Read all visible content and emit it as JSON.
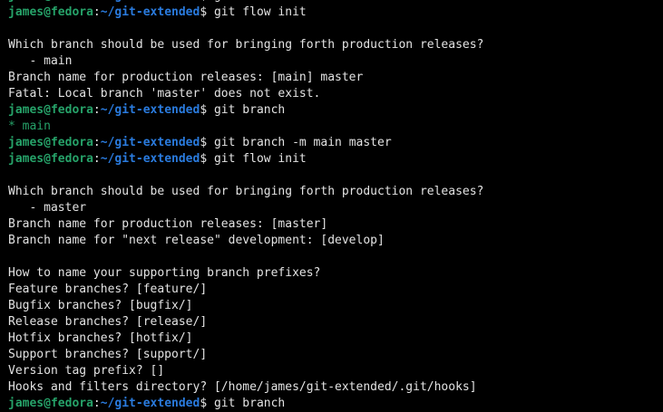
{
  "window": {
    "title": "james@fedora:~/git-extended"
  },
  "colors": {
    "background": "#000000",
    "foreground": "#e3e3e3",
    "prompt_user": "#26a269",
    "prompt_path": "#2a7bde"
  },
  "prompt": {
    "user_host": "james@fedora",
    "separator": ":",
    "path": "~/git-extended",
    "symbol": "$"
  },
  "lines": [
    {
      "type": "prompt",
      "command": " git flow init   ...   ...   ..."
    },
    {
      "type": "prompt",
      "command": " git flow init"
    },
    {
      "type": "text",
      "text": ""
    },
    {
      "type": "text",
      "text": "Which branch should be used for bringing forth production releases?"
    },
    {
      "type": "text",
      "text": "   - main"
    },
    {
      "type": "text",
      "text": "Branch name for production releases: [main] master"
    },
    {
      "type": "text",
      "text": "Fatal: Local branch 'master' does not exist."
    },
    {
      "type": "prompt",
      "command": " git branch"
    },
    {
      "type": "current-branch",
      "text": "* main"
    },
    {
      "type": "prompt",
      "command": " git branch -m main master"
    },
    {
      "type": "prompt",
      "command": " git flow init"
    },
    {
      "type": "text",
      "text": ""
    },
    {
      "type": "text",
      "text": "Which branch should be used for bringing forth production releases?"
    },
    {
      "type": "text",
      "text": "   - master"
    },
    {
      "type": "text",
      "text": "Branch name for production releases: [master]"
    },
    {
      "type": "text",
      "text": "Branch name for \"next release\" development: [develop]"
    },
    {
      "type": "text",
      "text": ""
    },
    {
      "type": "text",
      "text": "How to name your supporting branch prefixes?"
    },
    {
      "type": "text",
      "text": "Feature branches? [feature/]"
    },
    {
      "type": "text",
      "text": "Bugfix branches? [bugfix/]"
    },
    {
      "type": "text",
      "text": "Release branches? [release/]"
    },
    {
      "type": "text",
      "text": "Hotfix branches? [hotfix/]"
    },
    {
      "type": "text",
      "text": "Support branches? [support/]"
    },
    {
      "type": "text",
      "text": "Version tag prefix? []"
    },
    {
      "type": "text",
      "text": "Hooks and filters directory? [/home/james/git-extended/.git/hooks]"
    },
    {
      "type": "prompt",
      "command": " git branch"
    }
  ]
}
